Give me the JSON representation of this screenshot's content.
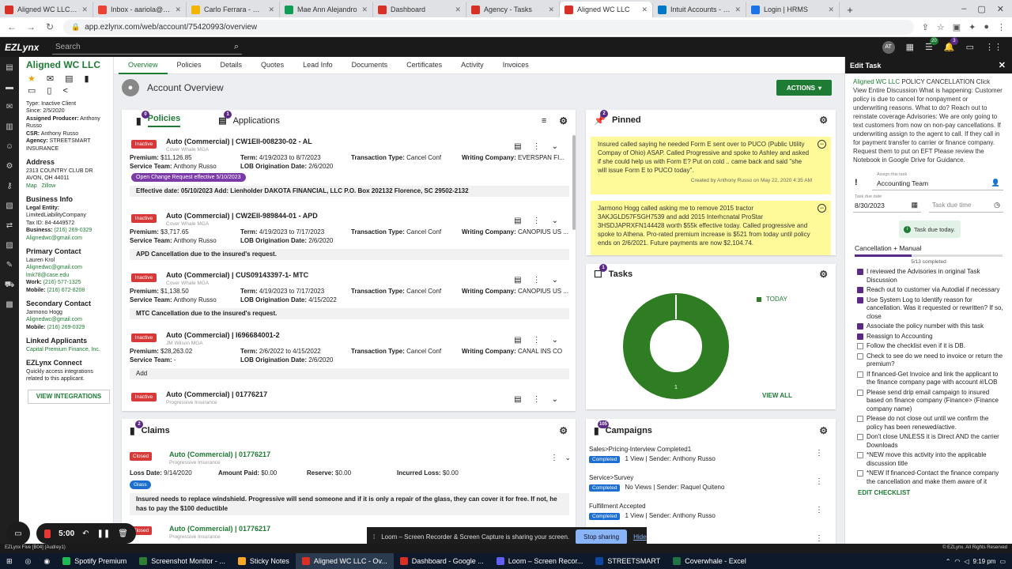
{
  "browser": {
    "tabs": [
      {
        "title": "Aligned WC LLC - Ac",
        "color": "#d93025"
      },
      {
        "title": "Inbox - aariola@insl",
        "color": "#ea4335"
      },
      {
        "title": "Carlo Ferrara - Chat",
        "color": "#f4b400"
      },
      {
        "title": "Mae Ann Alejandro",
        "color": "#0f9d58"
      },
      {
        "title": "Dashboard",
        "color": "#d93025"
      },
      {
        "title": "Agency - Tasks",
        "color": "#d93025"
      },
      {
        "title": "Aligned WC LLC",
        "color": "#d93025"
      },
      {
        "title": "Intuit Accounts - Sig",
        "color": "#0077c5"
      },
      {
        "title": "Login | HRMS",
        "color": "#1a73e8"
      }
    ],
    "url": "app.ezlynx.com/web/account/75420993/overview"
  },
  "header": {
    "logo": "EZLynx",
    "search_placeholder": "Search",
    "user_initials": "AT",
    "notif_count": "20",
    "alert_count": "3"
  },
  "client": {
    "name": "Aligned WC LLC",
    "type": "Type: Inactive Client",
    "since": "Since: 2/5/2020",
    "producer_label": "Assigned Producer:",
    "producer": "Anthony Russo",
    "csr_label": "CSR:",
    "csr": "Anthony Russo",
    "agency_label": "Agency:",
    "agency": "STREETSMART INSURANCE",
    "address_title": "Address",
    "address1": "2313 COUNTRY CLUB DR",
    "address2": "AVON, OH 44011",
    "map": "Map",
    "zillow": "Zillow",
    "biz_title": "Business Info",
    "legal_label": "Legal Entity:",
    "legal": "LimitedLiabilityCompany",
    "taxid": "Tax ID: 84-4449572",
    "biz_phone_label": "Business:",
    "biz_phone": "(216) 269-0329",
    "biz_email": "Alignedwc@gmail.com",
    "primary_title": "Primary Contact",
    "primary_name": "Lauren Krol",
    "primary_email1": "Alignedwc@gmail.com",
    "primary_email2": "lmk78@case.edu",
    "work_label": "Work:",
    "work": "(216) 577-1325",
    "mobile_label": "Mobile:",
    "mobile": "(216) 672-8208",
    "secondary_title": "Secondary Contact",
    "secondary_name": "Jarmono Hogg",
    "secondary_email": "Alignedwc@gmail.com",
    "secondary_mobile": "(216) 269-0329",
    "linked_title": "Linked Applicants",
    "linked": "Capital Premium Finance, Inc.",
    "connect_title": "EZLynx Connect",
    "connect_desc": "Quickly access integrations related to this applicant.",
    "view_integrations": "VIEW INTEGRATIONS"
  },
  "main_tabs": [
    "Overview",
    "Policies",
    "Details",
    "Quotes",
    "Lead Info",
    "Documents",
    "Certificates",
    "Activity",
    "Invoices"
  ],
  "overview": {
    "title": "Account Overview",
    "actions": "ACTIONS"
  },
  "policies_card": {
    "tab_policies": "Policies",
    "policies_count": "0",
    "tab_applications": "Applications",
    "applications_count": "1",
    "rows": [
      {
        "status": "Inactive",
        "title": "Auto (Commercial) | CW1EII-008230-02 - AL",
        "carrier": "Cover Whale MGA",
        "premium": "$11,126.85",
        "team": "Anthony Russo",
        "term": "4/19/2023 to 8/7/2023",
        "lob": "2/6/2020",
        "txn": "Cancel Conf",
        "company": "EVERSPAN FI...",
        "tag": "Open Change Request effective 5/10/2023",
        "note": "Effective date: 05/10/2023 Add: Lienholder DAKOTA FINANCIAL, LLC P.O. Box 202132 Florence, SC 29502-2132"
      },
      {
        "status": "Inactive",
        "title": "Auto (Commercial) | CW2EII-989844-01 - APD",
        "carrier": "Cover Whale MGA",
        "premium": "$3,717.65",
        "team": "Anthony Russo",
        "term": "4/19/2023 to 7/17/2023",
        "lob": "2/6/2020",
        "txn": "Cancel Conf",
        "company": "CANOPIUS US ...",
        "note": "APD Cancellation due to the insured's request."
      },
      {
        "status": "Inactive",
        "title": "Auto (Commercial) | CUS09143397-1- MTC",
        "carrier": "Cover Whale MGA",
        "premium": "$1,138.50",
        "team": "Anthony Russo",
        "term": "4/19/2023 to 7/17/2023",
        "lob": "4/15/2022",
        "txn": "Cancel Conf",
        "company": "CANOPIUS US ...",
        "note": "MTC Cancellation due to the insured's request."
      },
      {
        "status": "Inactive",
        "title": "Auto (Commercial) | I696684001-2",
        "carrier": "JM Wilson MGA",
        "premium": "$28,263.02",
        "team": "-",
        "term": "2/6/2022 to 4/15/2022",
        "lob": "2/6/2020",
        "txn": "Cancel Conf",
        "company": "CANAL INS CO",
        "note": "Add"
      },
      {
        "status": "Inactive",
        "title": "Auto (Commercial) | 01776217",
        "carrier": "Progressive Insurance"
      }
    ],
    "labels": {
      "premium": "Premium:",
      "team": "Service Team:",
      "term": "Term:",
      "lob": "LOB Origination Date:",
      "txn": "Transaction Type:",
      "company": "Writing Company:"
    }
  },
  "pinned": {
    "title": "Pinned",
    "count": "2",
    "notes": [
      {
        "text": "Insured called saying he needed Form E sent over to PUCO (Public Utility Compay of Ohio) ASAP. Called Progressive and spoke to Ashley and asked if she could help us with Form E? Put on cold .. came back and said \"she will issue Form E to PUCO today\".",
        "by": "Created by Anthony Russo on May 22, 2020 4:35 AM"
      },
      {
        "text": "Jarmono Hogg called asking me to remove 2015 tractor 3AKJGLD57FSGH7539 and add 2015 Interhcnatal ProStar 3HSDJAPRXFN144428 worth $55k effective today. Called progressive and spoke to Athena. Pro-rated premium increase is $521 from today until policy ends on 2/6/2021. Future payments are now $2,104.74."
      }
    ]
  },
  "tasks": {
    "title": "Tasks",
    "count": "1",
    "legend": "TODAY",
    "donut_value": "1",
    "view_all": "VIEW ALL",
    "color": "#2e7d23"
  },
  "claims": {
    "title": "Claims",
    "count": "2",
    "rows": [
      {
        "status": "Closed",
        "title": "Auto (Commercial) | 01776217",
        "carrier": "Progressive Insurance",
        "loss_label": "Loss Date:",
        "loss": "9/14/2020",
        "paid_label": "Amount Paid:",
        "paid": "$0.00",
        "reserve_label": "Reserve:",
        "reserve": "$0.00",
        "incurred_label": "Incurred Loss:",
        "incurred": "$0.00",
        "tag": "Glass",
        "note": "Insured needs to replace windshield. Progressive will send someone and if it is only a repair of the glass, they can cover it for free. If not, he has to pay the $100 deductible"
      },
      {
        "status": "Closed",
        "title": "Auto (Commercial) | 01776217",
        "carrier": "Progressive Insurance"
      }
    ]
  },
  "campaigns": {
    "title": "Campaigns",
    "count": "105",
    "rows": [
      {
        "name": "Sales>Pricing-Interview Completed1",
        "status": "Completed",
        "detail": "1 View | Sender: Anthony Russo"
      },
      {
        "name": "Service>Survey",
        "status": "Completed",
        "detail": "No Views | Sender: Raquel Quiteno"
      },
      {
        "name": "Fulfillment Accepted",
        "status": "Completed",
        "detail": "1 View | Sender: Anthony Russo"
      },
      {
        "name": "",
        "status": "",
        "detail": "ted"
      }
    ]
  },
  "edit_task": {
    "title": "Edit Task",
    "link": "Aligned WC LLC",
    "description": "POLICY CANCELLATION Click View Entire Discussion What is happening: Customer policy is due to cancel for nonpayment or underwriting reasons. What to do? Reach out to reinstate coverage Advisories: We are only going to text customers from now on non-pay cancellations. If underwriting assign to the agent to call. If they call in for payment transfer to carrier or finance company. Request them to put on EFT Please review the Notebook in Google Drive for Guidance.",
    "assign_label": "Assign this task",
    "assign_value": "Accounting Team",
    "due_label": "Task due date",
    "due_date": "8/30/2023",
    "due_time_placeholder": "Task due time",
    "due_today": "Task due today.",
    "checklist_title": "Cancellation + Manual",
    "checklist_progress": "5/13 completed",
    "checklist_fraction": 0.3846,
    "items": [
      {
        "text": "I reviewed the Advisories in original Task Discussion",
        "checked": true
      },
      {
        "text": "Reach out to customer via Autodial if necessary",
        "checked": true
      },
      {
        "text": "Use System Log to Identify reason for cancellation. Was it requested or rewritten? If so, close",
        "checked": true
      },
      {
        "text": "Associate the policy number with this task",
        "checked": true
      },
      {
        "text": "Reassign to Accounting",
        "checked": true
      },
      {
        "text": "Follow the checklist even if it is DB.",
        "checked": false
      },
      {
        "text": "Check to see do we need to invoice or return the premium?",
        "checked": false
      },
      {
        "text": "If financed-Get Invoice and link the applicant to the finance company page with account #/LOB",
        "checked": false
      },
      {
        "text": "Please send drip email campaign to insured based on finance company (Finance> (Finance company name)",
        "checked": false
      },
      {
        "text": "Please do not close out until we confirm the policy has been renewed/active.",
        "checked": false
      },
      {
        "text": "Don't close UNLESS it is Direct AND the carrier Downloads",
        "checked": false
      },
      {
        "text": "*NEW move this activity into the applicable discussion title",
        "checked": false
      },
      {
        "text": "*NEW If financed-Contact the finance company the cancellation and make them aware of it",
        "checked": false
      }
    ],
    "edit_checklist": "EDIT CHECKLIST"
  },
  "overlays": {
    "recorder_time": "5:00",
    "loom_msg": "Loom – Screen Recorder & Screen Capture is sharing your screen.",
    "stop_sharing": "Stop sharing",
    "hide": "Hide"
  },
  "status_strip": {
    "left": "EZLynx Five [B04] (Audrey1)",
    "right": "© EZLynx. All Rights Reserved"
  },
  "taskbar": {
    "items": [
      "Spotify Premium",
      "Screenshot Monitor - ...",
      "Sticky Notes",
      "Aligned WC LLC - Ov...",
      "Dashboard - Google ...",
      "Loom – Screen Recor...",
      "STREETSMART",
      "Coverwhale - Excel"
    ],
    "time": "9:19 pm"
  }
}
